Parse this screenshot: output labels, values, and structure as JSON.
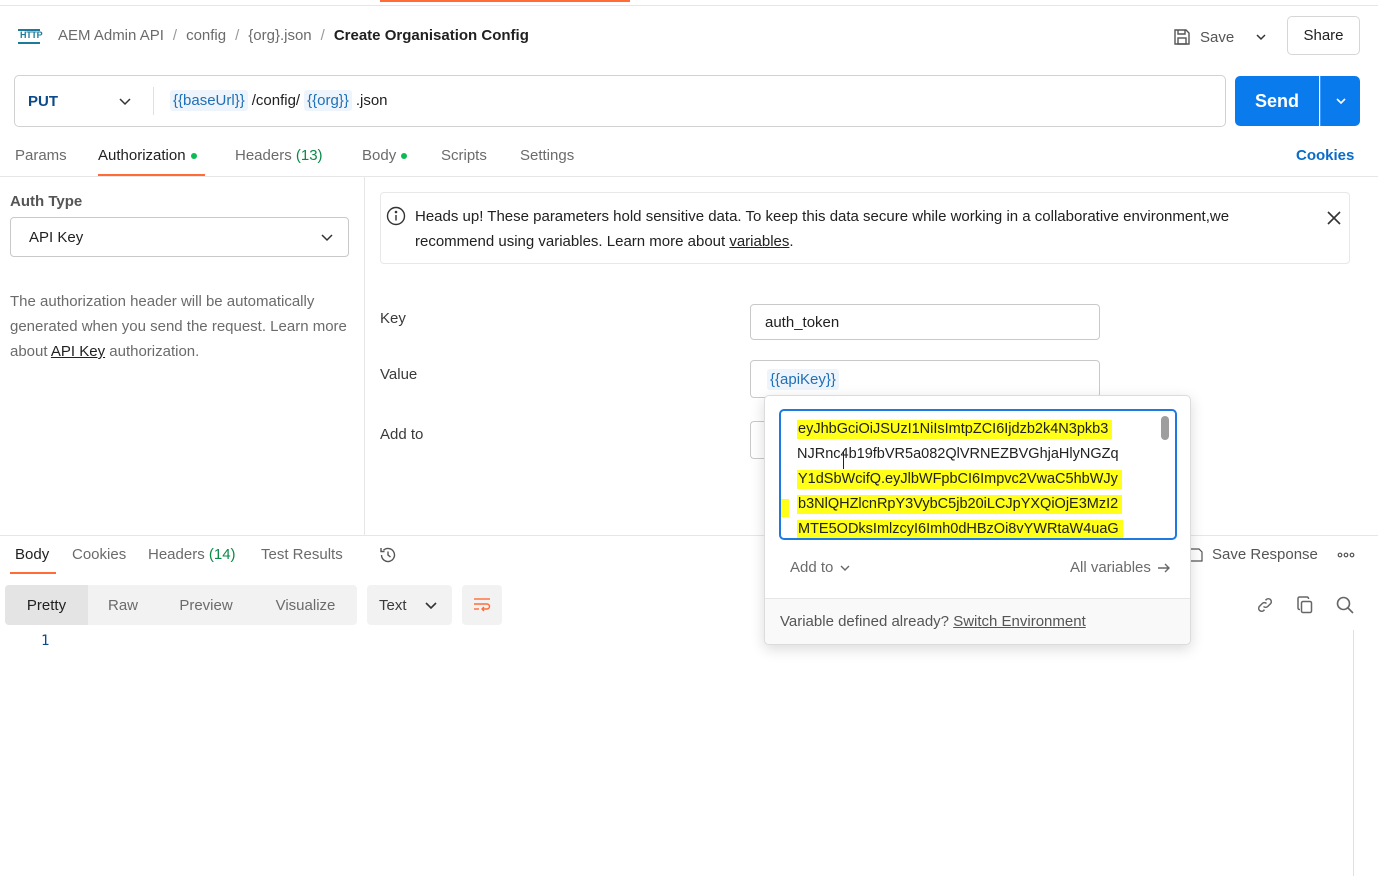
{
  "header": {
    "api_icon_label": "HTTP",
    "breadcrumb": [
      "AEM Admin API",
      "config",
      "{org}.json"
    ],
    "separator": "/",
    "title": "Create Organisation Config",
    "save_label": "Save",
    "share_label": "Share"
  },
  "request": {
    "method": "PUT",
    "url_parts": [
      {
        "type": "var",
        "text": "{{baseUrl}}"
      },
      {
        "type": "text",
        "text": "/config/"
      },
      {
        "type": "var",
        "text": "{{org}}"
      },
      {
        "type": "text",
        "text": ".json"
      }
    ],
    "send_label": "Send"
  },
  "request_tabs": {
    "params": "Params",
    "authorization": "Authorization",
    "headers": "Headers",
    "headers_count": "(13)",
    "body": "Body",
    "scripts": "Scripts",
    "settings": "Settings",
    "cookies": "Cookies"
  },
  "auth": {
    "type_label": "Auth Type",
    "type_value": "API Key",
    "desc_before": "The authorization header will be automatically generated when you send the request. Learn more about ",
    "desc_link": "API Key",
    "desc_after": " authorization."
  },
  "banner": {
    "text": "Heads up! These parameters hold sensitive data. To keep this data secure while working in a collaborative environment,we recommend using variables. Learn more about ",
    "link": "variables",
    "end": "."
  },
  "fields": {
    "key_label": "Key",
    "key_value": "auth_token",
    "value_label": "Value",
    "value_value": "{{apiKey}}",
    "addto_label": "Add to"
  },
  "popover": {
    "token_lines": [
      "eyJhbGciOiJSUzI1NiIsImtpZCI6Ijdzb2k4N3pkb3",
      "NJRnc4b19fbVR5a082QlVRNEZBVGhjaHlyNGZq",
      "Y1dSbWcifQ.eyJlbWFpbCI6Impvc2VwaC5hbWJy",
      "b3NlQHZlcnRpY3VybC5jb20iLCJpYXQiOjE3MzI2",
      "MTE5ODksImlzcyI6Imh0dHBzOi8vYWRtaW4uaG"
    ],
    "add_to": "Add to",
    "all_variables": "All variables",
    "footer_text": "Variable defined already? ",
    "footer_link": "Switch Environment",
    "highlight_color": "#ffff17"
  },
  "response": {
    "tabs": {
      "body": "Body",
      "cookies": "Cookies",
      "headers": "Headers",
      "headers_count": "(14)",
      "test_results": "Test Results"
    },
    "views": [
      "Pretty",
      "Raw",
      "Preview",
      "Visualize"
    ],
    "format": "Text",
    "save_response": "Save Response",
    "line_number": "1"
  },
  "colors": {
    "accent": "#ff6c37",
    "send": "#097bed",
    "link": "#0b6bc8",
    "variable": "#1f6fb5",
    "status_dot": "#0cbb52"
  }
}
